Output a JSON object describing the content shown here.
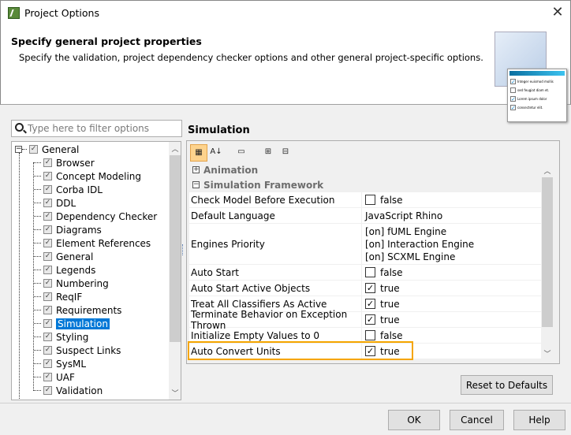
{
  "window": {
    "title": "Project Options",
    "close_icon": "close-icon"
  },
  "header": {
    "title": "Specify general project properties",
    "description": "Specify the validation, project dependency checker options and other general project-specific options.",
    "illustration_lines": [
      "Integer euismod mollis",
      "sed feugiat diam et.",
      "Lorem ipsum dolor",
      "consectetur elit."
    ],
    "illustration_checked": [
      true,
      false,
      true,
      true
    ]
  },
  "filter": {
    "placeholder": "Type here to filter options",
    "value": ""
  },
  "tree": {
    "root": {
      "label": "General",
      "checked": true,
      "expanded": true
    },
    "children": [
      {
        "label": "Browser",
        "checked": true
      },
      {
        "label": "Concept Modeling",
        "checked": true
      },
      {
        "label": "Corba IDL",
        "checked": true
      },
      {
        "label": "DDL",
        "checked": true
      },
      {
        "label": "Dependency Checker",
        "checked": true
      },
      {
        "label": "Diagrams",
        "checked": true
      },
      {
        "label": "Element References",
        "checked": true
      },
      {
        "label": "General",
        "checked": true
      },
      {
        "label": "Legends",
        "checked": true
      },
      {
        "label": "Numbering",
        "checked": true
      },
      {
        "label": "ReqIF",
        "checked": true
      },
      {
        "label": "Requirements",
        "checked": true
      },
      {
        "label": "Simulation",
        "checked": true,
        "selected": true
      },
      {
        "label": "Styling",
        "checked": true
      },
      {
        "label": "Suspect Links",
        "checked": true
      },
      {
        "label": "SysML",
        "checked": true
      },
      {
        "label": "UAF",
        "checked": true
      },
      {
        "label": "Validation",
        "checked": true
      }
    ]
  },
  "section": {
    "title": "Simulation"
  },
  "toolbar": [
    {
      "name": "categorized-view-icon",
      "glyph": "▦",
      "active": true
    },
    {
      "name": "sort-alphabetical-icon",
      "glyph": "A↓"
    },
    {
      "name": "description-icon",
      "glyph": "▭"
    },
    {
      "name": "expand-all-icon",
      "glyph": "⊞"
    },
    {
      "name": "collapse-all-icon",
      "glyph": "⊟"
    }
  ],
  "groups": {
    "animation": "Animation",
    "framework": "Simulation Framework"
  },
  "properties": [
    {
      "name": "Check Model Before Execution",
      "type": "bool",
      "value": "false",
      "checked": false
    },
    {
      "name": "Default Language",
      "type": "text",
      "value": "JavaScript Rhino"
    },
    {
      "name": "Engines Priority",
      "type": "list",
      "values": [
        "[on] fUML Engine",
        "[on] Interaction Engine",
        "[on] SCXML Engine"
      ]
    },
    {
      "name": "Auto Start",
      "type": "bool",
      "value": "false",
      "checked": false
    },
    {
      "name": "Auto Start Active Objects",
      "type": "bool",
      "value": "true",
      "checked": true
    },
    {
      "name": "Treat All Classifiers As Active",
      "type": "bool",
      "value": "true",
      "checked": true
    },
    {
      "name": "Terminate Behavior on Exception Thrown",
      "type": "bool",
      "value": "true",
      "checked": true
    },
    {
      "name": "Initialize Empty Values to 0",
      "type": "bool",
      "value": "false",
      "checked": false
    },
    {
      "name": "Auto Convert Units",
      "type": "bool",
      "value": "true",
      "checked": true,
      "highlighted": true
    }
  ],
  "highlight_color": "#f5a500",
  "selection_color": "#0078d7",
  "buttons": {
    "reset": "Reset to Defaults",
    "ok": "OK",
    "cancel": "Cancel",
    "help": "Help"
  }
}
